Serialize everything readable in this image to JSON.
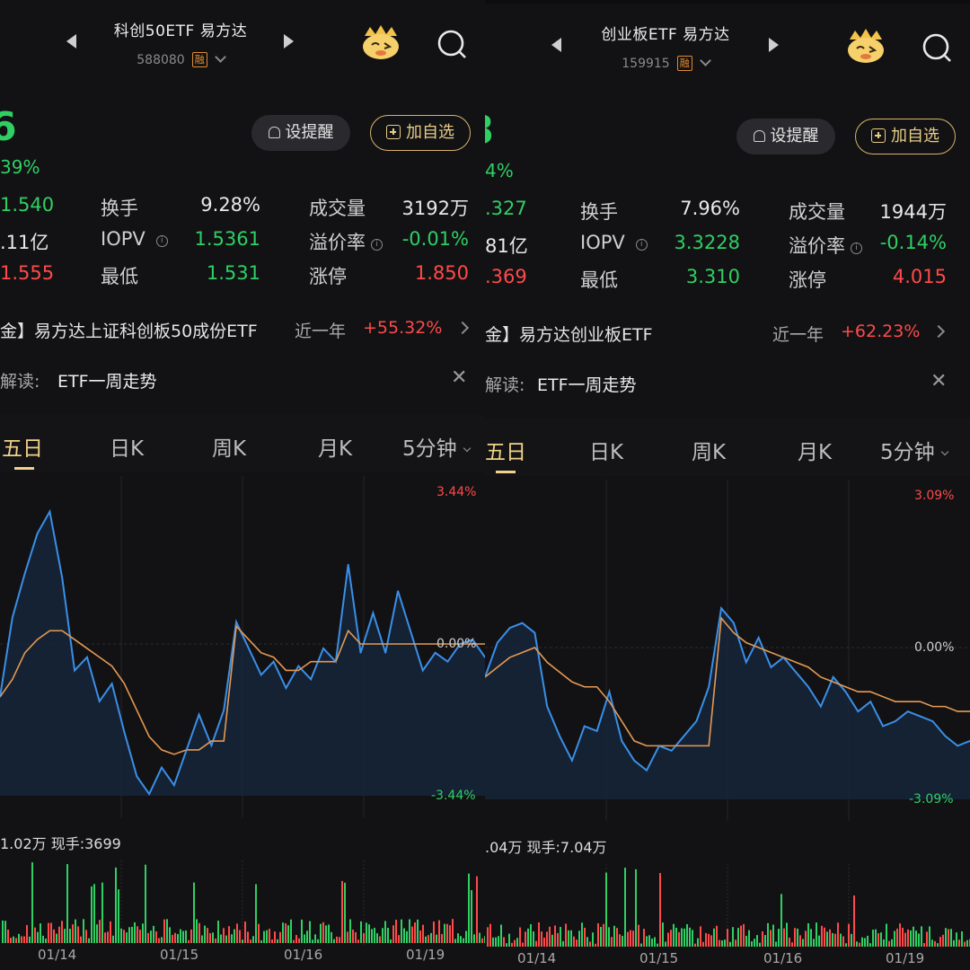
{
  "colors": {
    "up": "#ff4a4a",
    "down": "#2fcf64",
    "line": "#3a8fe8",
    "avg": "#e59a52",
    "accent": "#f0d28a"
  },
  "tabs": [
    "五日",
    "日K",
    "周K",
    "月K",
    "5分钟"
  ],
  "buttons": {
    "remind": "设提醒",
    "add": "加自选"
  },
  "left": {
    "title": "科创50ETF 易方达",
    "code": "588080",
    "rong": "融",
    "price_stub": "6",
    "pct_stub": "39%",
    "col1": [
      "1.540",
      ".11亿",
      "1.555"
    ],
    "stats": [
      {
        "label": "换手",
        "value": "9.28%",
        "label2": "成交量",
        "value2": "3192万"
      },
      {
        "label": "IOPV",
        "value": "1.5361",
        "label2": "溢价率",
        "value2": "-0.01%"
      },
      {
        "label": "最低",
        "value": "1.531",
        "label2": "涨停",
        "value2": "1.850"
      }
    ],
    "fund_name": "金】易方达上证科创板50成份ETF",
    "fund_period": "近一年",
    "fund_return": "+55.32%",
    "read_label": "解读:",
    "read_text": "ETF一周走势",
    "y_top": "3.44%",
    "y_mid": "0.00%",
    "y_bot": "-3.44%",
    "vol_label": "1.02万 现手:3699",
    "dates": [
      "01/14",
      "01/15",
      "01/16",
      "01/19"
    ]
  },
  "right": {
    "title": "创业板ETF 易方达",
    "code": "159915",
    "rong": "融",
    "price_stub": "3",
    "pct_stub": "4%",
    "col1": [
      ".327",
      "81亿",
      ".369"
    ],
    "stats": [
      {
        "label": "换手",
        "value": "7.96%",
        "label2": "成交量",
        "value2": "1944万"
      },
      {
        "label": "IOPV",
        "value": "3.3228",
        "label2": "溢价率",
        "value2": "-0.14%"
      },
      {
        "label": "最低",
        "value": "3.310",
        "label2": "涨停",
        "value2": "4.015"
      }
    ],
    "fund_name": "金】易方达创业板ETF",
    "fund_period": "近一年",
    "fund_return": "+62.23%",
    "read_label": "解读:",
    "read_text": "ETF一周走势",
    "y_top": "3.09%",
    "y_mid": "0.00%",
    "y_bot": "-3.09%",
    "vol_label": ".04万 现手:7.04万",
    "dates": [
      "01/14",
      "01/15",
      "01/16",
      "01/19"
    ]
  },
  "chart_data": [
    {
      "type": "line",
      "x": [
        "01/14",
        "01/15",
        "01/16",
        "01/19"
      ],
      "ylim": [
        -3.44,
        3.44
      ],
      "series": [
        {
          "values": [
            -1.2,
            0.6,
            1.6,
            2.5,
            3.0,
            1.5,
            -0.6,
            -0.3,
            -1.3,
            -0.9,
            -2.0,
            -3.0,
            -3.4,
            -2.8,
            -3.2,
            -2.4,
            -1.6,
            -2.3,
            -1.5,
            0.5,
            -0.1,
            -0.7,
            -0.4,
            -1.0,
            -0.5,
            -0.8,
            -0.1,
            -0.4,
            1.8,
            -0.2,
            0.7,
            -0.2,
            1.2,
            0.3,
            -0.6,
            -0.2,
            -0.4,
            0.0,
            0.1,
            -0.3
          ]
        },
        {
          "values": [
            -1.2,
            -0.8,
            -0.2,
            0.1,
            0.3,
            0.3,
            0.1,
            -0.1,
            -0.3,
            -0.5,
            -0.9,
            -1.5,
            -2.1,
            -2.4,
            -2.5,
            -2.4,
            -2.4,
            -2.2,
            -2.2,
            0.4,
            0.1,
            -0.2,
            -0.3,
            -0.6,
            -0.6,
            -0.4,
            -0.4,
            -0.4,
            0.3,
            0.0,
            0.0,
            0.0,
            0.0,
            0.0,
            0.0,
            0.0,
            0.0,
            0.0,
            0.0,
            0.0
          ]
        }
      ]
    },
    {
      "type": "line",
      "x": [
        "01/14",
        "01/15",
        "01/16",
        "01/19"
      ],
      "ylim": [
        -3.09,
        3.09
      ],
      "series": [
        {
          "values": [
            -0.6,
            0.1,
            0.4,
            0.5,
            0.3,
            -1.2,
            -1.8,
            -2.3,
            -1.6,
            -1.7,
            -0.9,
            -1.9,
            -2.3,
            -2.5,
            -2.0,
            -2.1,
            -1.8,
            -1.5,
            -0.8,
            0.8,
            0.5,
            -0.3,
            0.2,
            -0.4,
            -0.2,
            -0.5,
            -0.8,
            -1.2,
            -0.6,
            -0.9,
            -1.3,
            -1.1,
            -1.6,
            -1.5,
            -1.3,
            -1.4,
            -1.5,
            -1.8,
            -2.0,
            -1.9
          ]
        },
        {
          "values": [
            -0.6,
            -0.4,
            -0.2,
            -0.1,
            0.0,
            -0.3,
            -0.5,
            -0.7,
            -0.8,
            -0.8,
            -1.1,
            -1.5,
            -1.9,
            -2.0,
            -2.0,
            -2.0,
            -2.0,
            -2.0,
            -2.0,
            0.6,
            0.3,
            0.1,
            0.0,
            -0.1,
            -0.2,
            -0.3,
            -0.4,
            -0.6,
            -0.7,
            -0.8,
            -0.9,
            -0.9,
            -1.0,
            -1.1,
            -1.1,
            -1.1,
            -1.2,
            -1.2,
            -1.3,
            -1.3
          ]
        }
      ]
    }
  ]
}
